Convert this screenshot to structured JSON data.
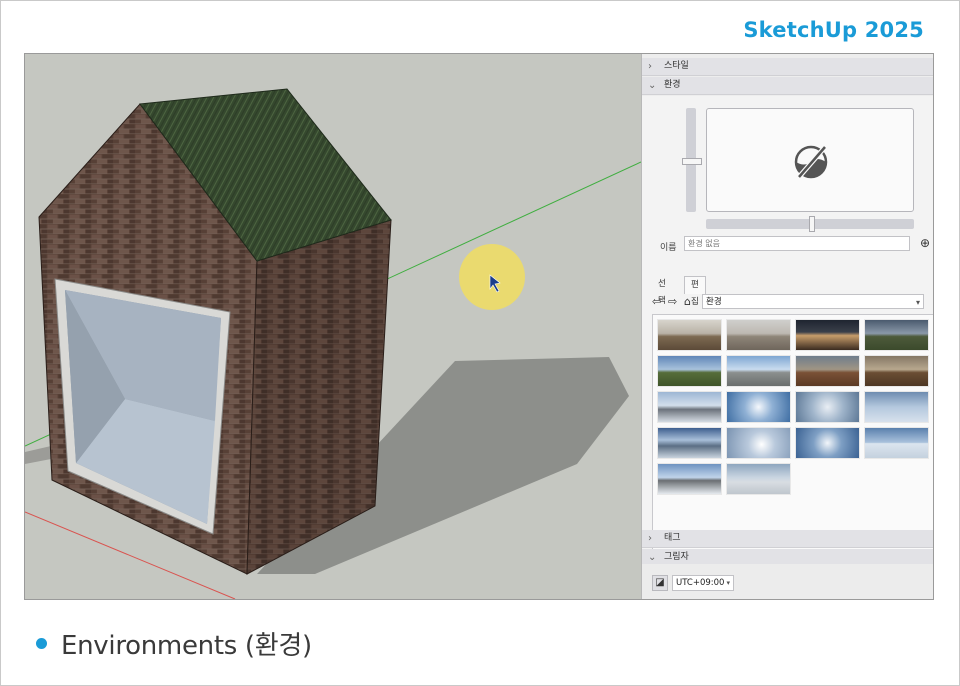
{
  "header": {
    "brand": "SketchUp 2025"
  },
  "caption": {
    "text": "Environments (환경)"
  },
  "tray": {
    "sections": {
      "styles": "스타일",
      "environment": "환경",
      "tags": "태그",
      "shadows": "그림자"
    },
    "environment_panel": {
      "name_label": "이름",
      "name_placeholder": "환경 없음",
      "tabs": [
        "선택",
        "편집"
      ],
      "collection": "환경",
      "thumbnail_count": 18
    },
    "shadows_panel": {
      "timezone": "UTC+09:00"
    }
  },
  "colors": {
    "brand": "#1a9bd7",
    "cursor_highlight": "#f0dd60",
    "green_axis": "#3fae3f",
    "red_axis": "#d9534f"
  },
  "icons": [
    "no-environment-icon",
    "add-icon",
    "back-arrow-icon",
    "forward-arrow-icon",
    "home-icon",
    "chevron-down-icon",
    "chevron-right-icon",
    "shadow-toggle-icon",
    "mouse-cursor-icon"
  ]
}
